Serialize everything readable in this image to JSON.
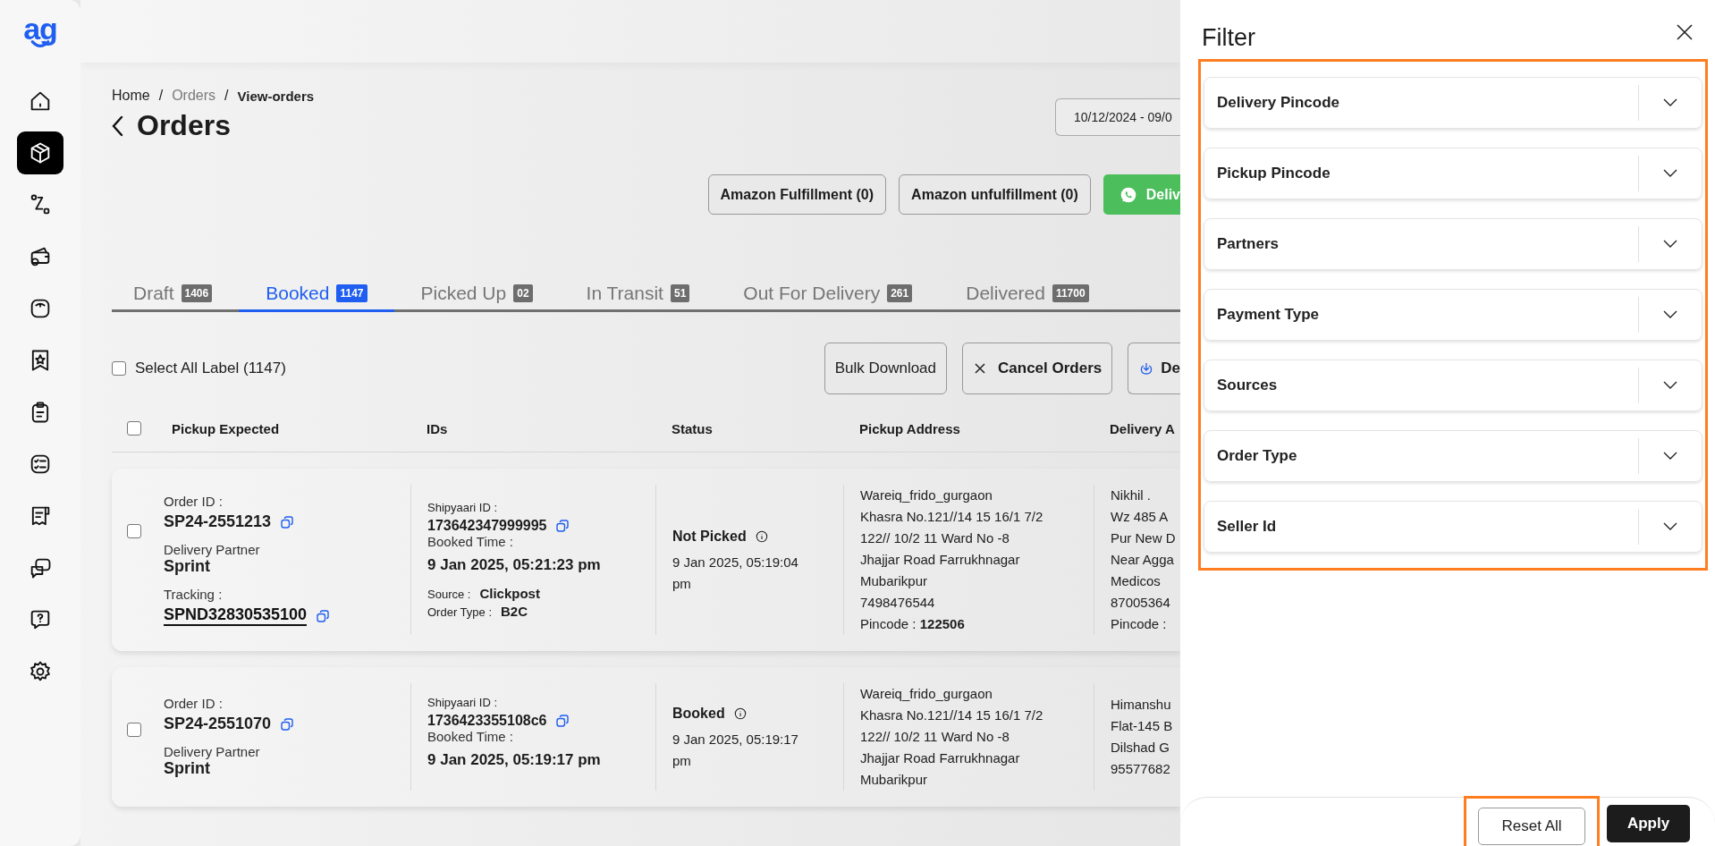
{
  "sidebar": {
    "logo": "ag",
    "items": [
      {
        "selected": false
      },
      {
        "selected": true
      },
      {
        "selected": false
      },
      {
        "selected": false
      },
      {
        "selected": false
      },
      {
        "selected": false
      },
      {
        "selected": false
      },
      {
        "selected": false
      },
      {
        "selected": false
      },
      {
        "selected": false
      },
      {
        "selected": false
      },
      {
        "selected": false
      }
    ]
  },
  "breadcrumb": [
    {
      "label": "Home",
      "current": false
    },
    {
      "label": "Orders",
      "current": false
    },
    {
      "label": "View-orders",
      "current": true
    }
  ],
  "breadcrumb_separator": "/",
  "page_title": "Orders",
  "date_range": "10/12/2024 - 09/0",
  "action_buttons": [
    "Amazon Fulfillment (0)",
    "Amazon unfulfillment (0)"
  ],
  "whatsapp_button": "Deliv",
  "tabs": [
    {
      "label": "Draft",
      "count": "1406",
      "selected": false
    },
    {
      "label": "Booked",
      "count": "1147",
      "selected": true
    },
    {
      "label": "Picked Up",
      "count": "02",
      "selected": false
    },
    {
      "label": "In Transit",
      "count": "51",
      "selected": false
    },
    {
      "label": "Out For Delivery",
      "count": "261",
      "selected": false
    },
    {
      "label": "Delivered",
      "count": "11700",
      "selected": false
    }
  ],
  "select_all": {
    "label": "Select All Label (1147)",
    "checked": false
  },
  "toolbar": {
    "bulk_download": "Bulk Download",
    "cancel_orders": "Cancel Orders",
    "download": "De"
  },
  "table": {
    "header_checked": false,
    "columns": [
      "Pickup Expected",
      "IDs",
      "Status",
      "Pickup Address",
      "Delivery A"
    ],
    "rows": [
      {
        "checked": false,
        "order_id_label": "Order ID :",
        "order_id": "SP24-2551213",
        "partner_label": "Delivery Partner",
        "partner": "Sprint",
        "tracking_label": "Tracking :",
        "tracking": "SPND32830535100",
        "shipyaari_label": "Shipyaari ID :",
        "shipyaari_id": "173642347999995",
        "booked_label": "Booked Time :",
        "booked_time": "9 Jan 2025, 05:21:23 pm",
        "source_label": "Source :",
        "source": "Clickpost",
        "order_type_label": "Order Type :",
        "order_type": "B2C",
        "status": "Not Picked",
        "status_time": "9 Jan 2025, 05:19:04 pm",
        "pickup_address": [
          "Wareiq_frido_gurgaon",
          "Khasra No.121//14 15 16/1 7/2",
          "122// 10/2 11 Ward No -8",
          "Jhajjar Road Farrukhnagar",
          "Mubarikpur",
          "7498476544"
        ],
        "pickup_pincode": "Pincode : **122506**",
        "delivery_address": [
          "Nikhil .",
          "Wz 485 A",
          "Pur New D",
          "Near Agga",
          "Medicos",
          "87005364"
        ],
        "delivery_pincode": "Pincode :"
      },
      {
        "checked": false,
        "order_id_label": "Order ID :",
        "order_id": "SP24-2551070",
        "partner_label": "Delivery Partner",
        "partner": "Sprint",
        "shipyaari_label": "Shipyaari ID :",
        "shipyaari_id": "1736423355108c6",
        "booked_label": "Booked Time :",
        "booked_time": "9 Jan 2025, 05:19:17 pm",
        "status": "Booked",
        "status_time": "9 Jan 2025, 05:19:17 pm",
        "pickup_address": [
          "Wareiq_frido_gurgaon",
          "Khasra No.121//14 15 16/1 7/2",
          "122// 10/2 11 Ward No -8",
          "Jhajjar Road Farrukhnagar",
          "Mubarikpur"
        ],
        "delivery_address": [
          "Himanshu",
          "Flat-145 B",
          "Dilshad G",
          "95577682"
        ]
      }
    ]
  },
  "filter": {
    "title": "Filter",
    "items": [
      {
        "label": "Delivery Pincode"
      },
      {
        "label": "Pickup Pincode"
      },
      {
        "label": "Partners"
      },
      {
        "label": "Payment Type"
      },
      {
        "label": "Sources"
      },
      {
        "label": "Order Type"
      },
      {
        "label": "Seller Id"
      }
    ],
    "reset_button": "Reset All",
    "apply_button": "Apply"
  }
}
